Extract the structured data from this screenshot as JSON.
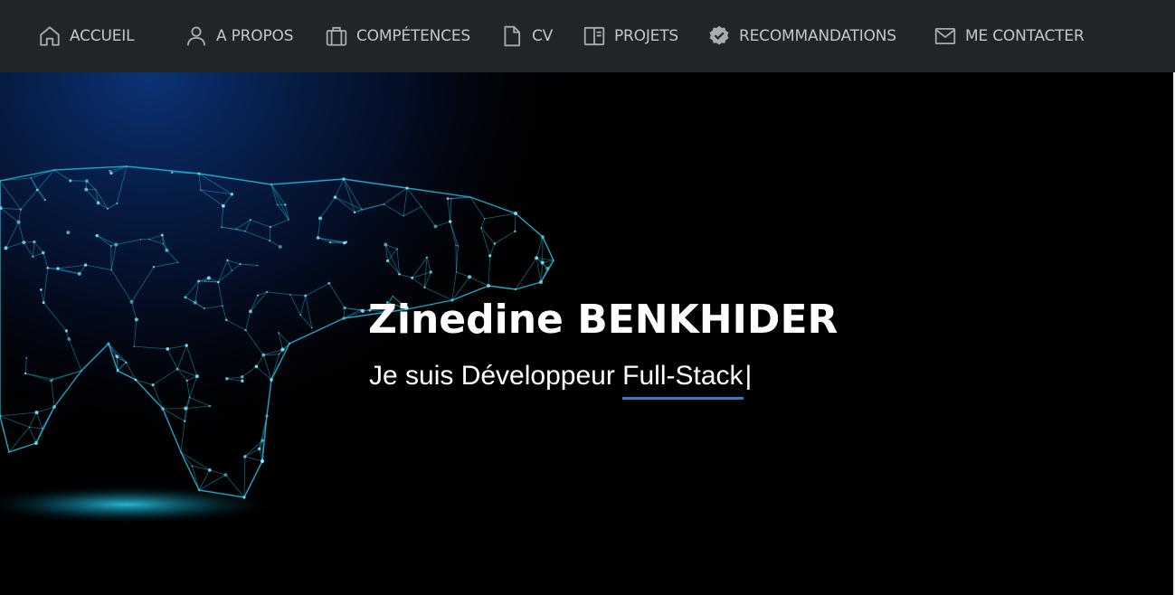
{
  "nav": {
    "items": [
      {
        "label": "ACCUEIL",
        "icon": "home-icon"
      },
      {
        "label": "A PROPOS",
        "icon": "user-icon"
      },
      {
        "label": "COMPÉTENCES",
        "icon": "briefcase-icon"
      },
      {
        "label": "CV",
        "icon": "document-icon"
      },
      {
        "label": "PROJETS",
        "icon": "columns-icon"
      },
      {
        "label": "RECOMMANDATIONS",
        "icon": "verified-badge-icon"
      },
      {
        "label": "ME CONTACTER",
        "icon": "envelope-icon"
      }
    ]
  },
  "hero": {
    "name": "Zinedine BENKHIDER",
    "intro": "Je suis Développeur",
    "typed_role": "Full-Stack",
    "cursor": "|"
  },
  "colors": {
    "navbar_bg": "#212429",
    "nav_text": "#c3c6cb",
    "hero_bg": "#000000",
    "accent_underline": "#2f7fd0",
    "network_cyan": "#1fb6d8"
  }
}
